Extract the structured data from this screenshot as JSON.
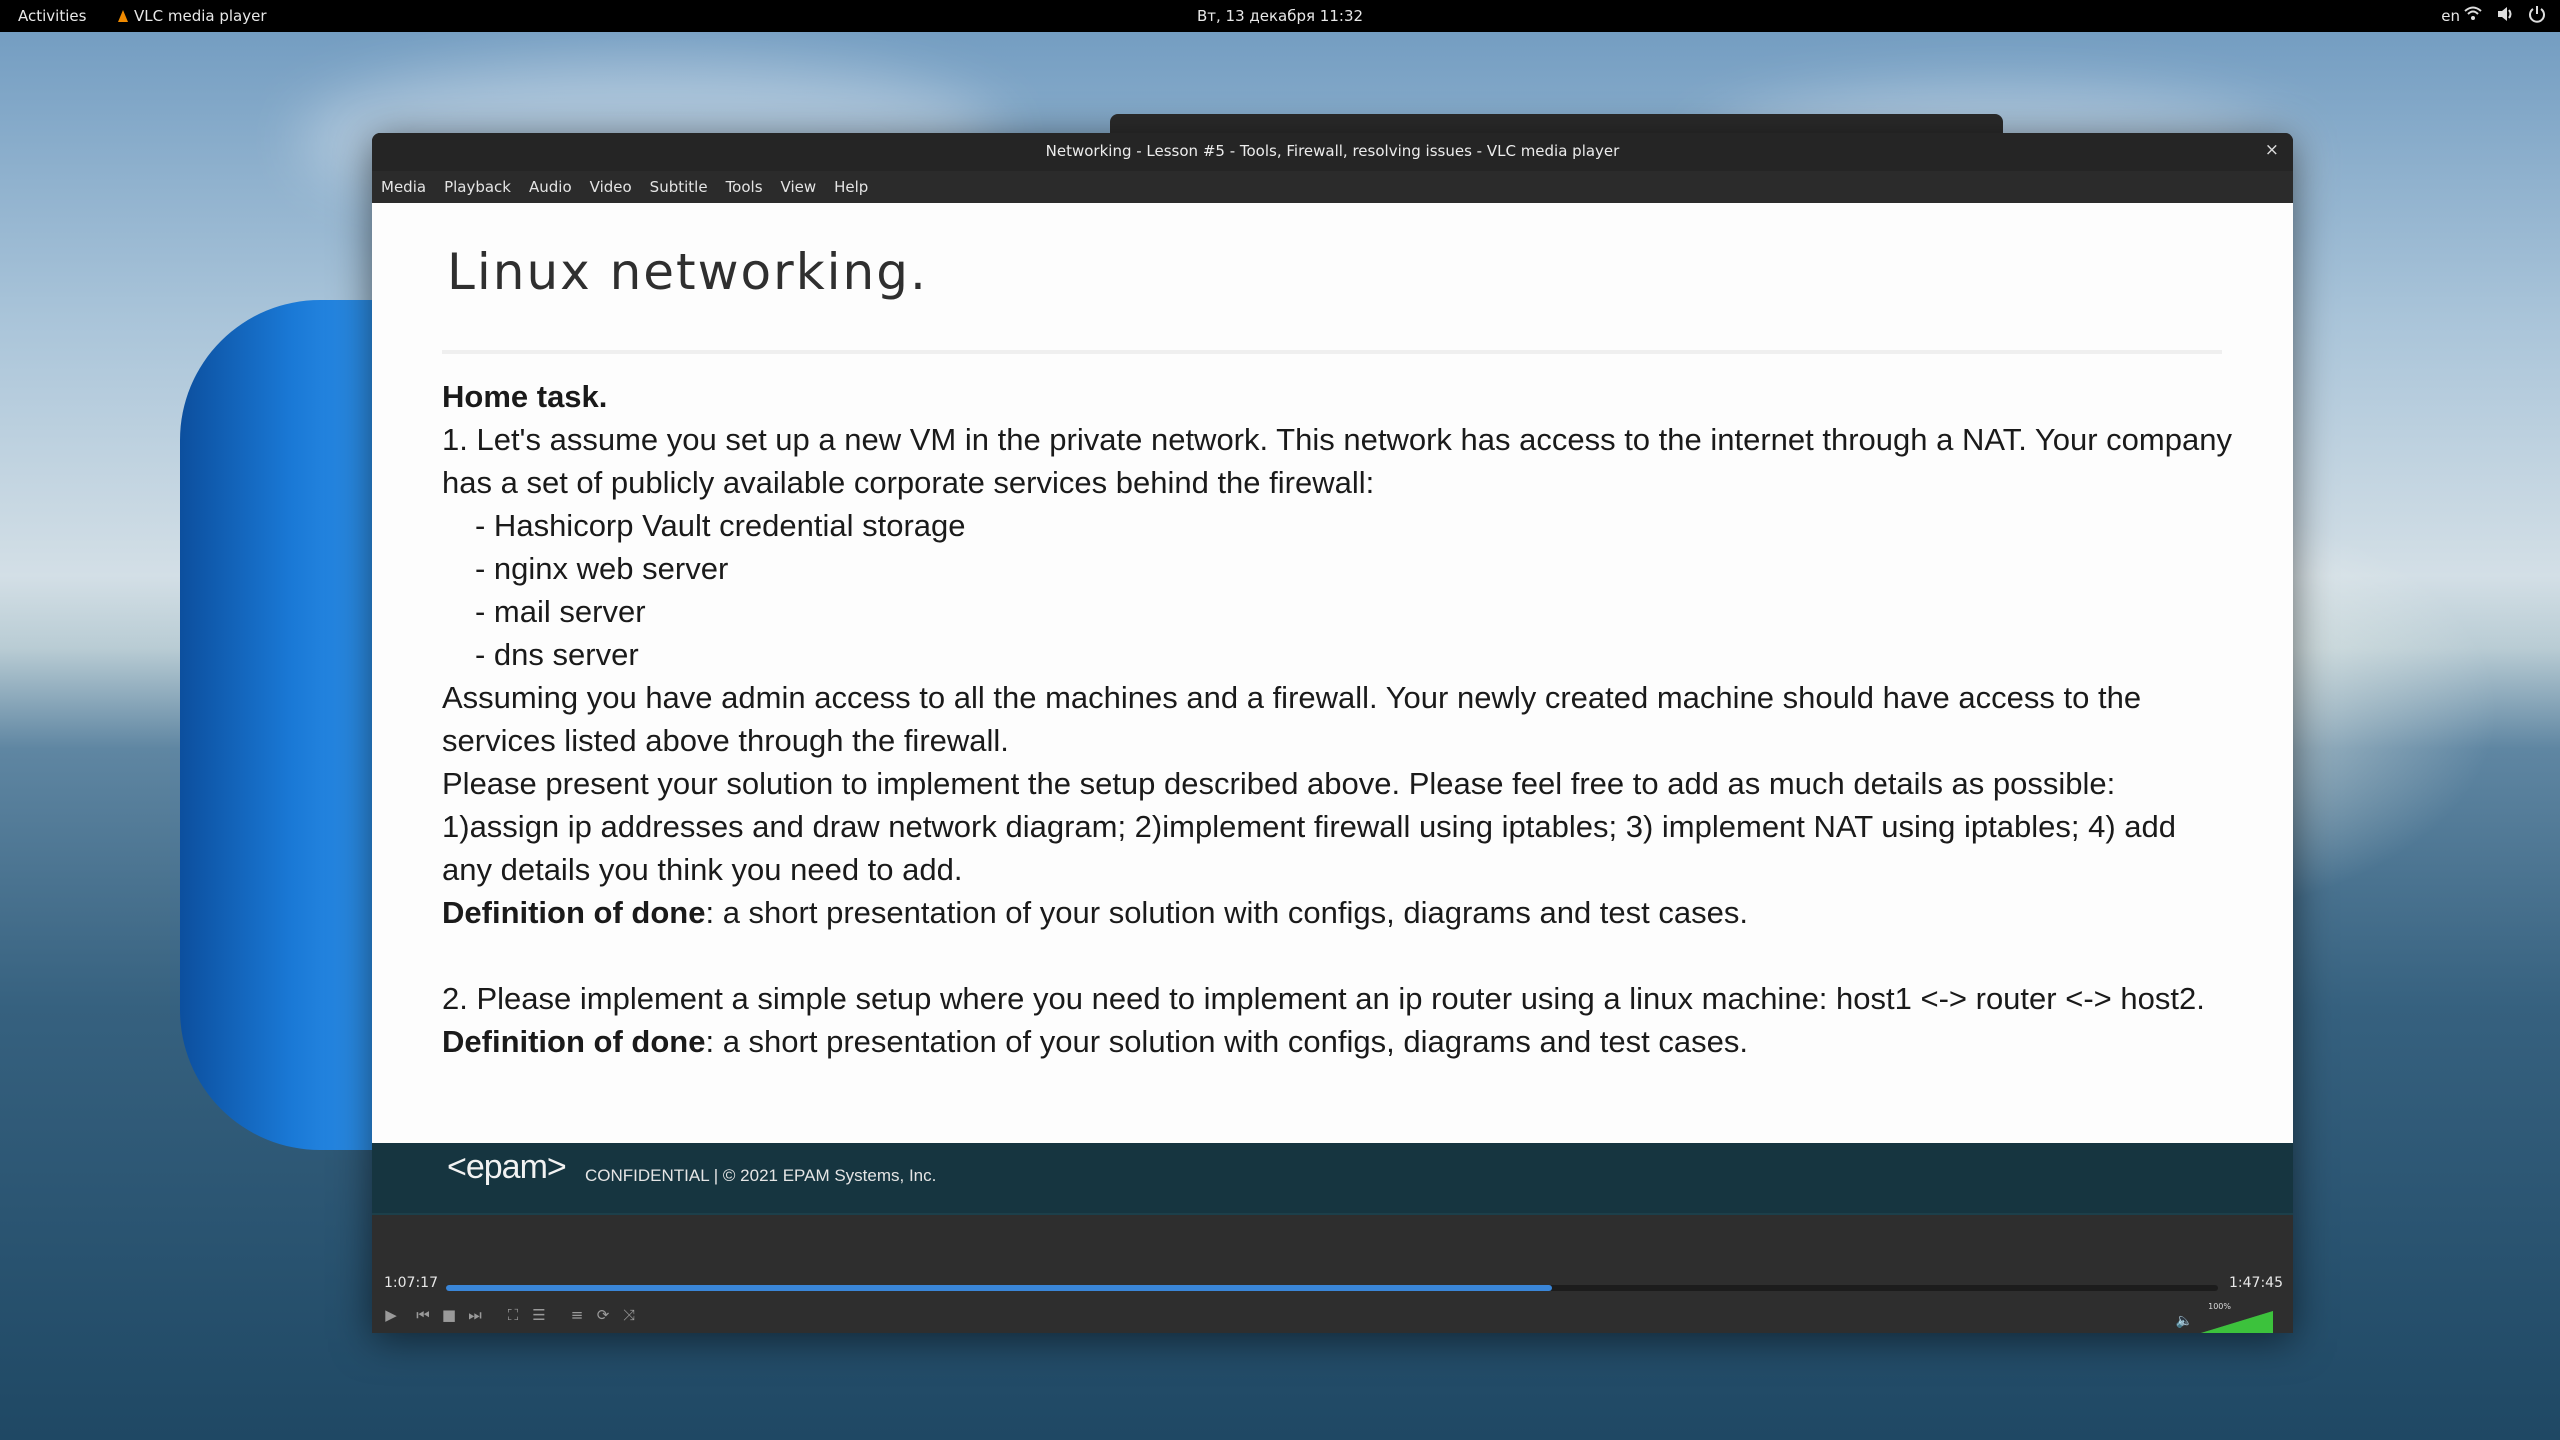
{
  "topbar": {
    "activities": "Activities",
    "app_name": "VLC media player",
    "clock": "Вт, 13 декабря  11:32",
    "language": "en"
  },
  "window": {
    "title": "Networking - Lesson #5 - Tools, Firewall, resolving issues - VLC media player",
    "close": "×"
  },
  "menu": [
    "Media",
    "Playback",
    "Audio",
    "Video",
    "Subtitle",
    "Tools",
    "View",
    "Help"
  ],
  "slide": {
    "title": "Linux networking.",
    "home_task": "Home task.",
    "task1_line1": "1. Let's assume you set up a new VM in the private network. This network has access to the internet through a NAT. Your company has a set of publicly available corporate services behind the firewall:",
    "bullets": [
      "- Hashicorp Vault credential storage",
      "- nginx web server",
      "- mail server",
      "- dns server"
    ],
    "assumption": "Assuming you have admin access to all the machines and a firewall. Your newly created machine should have access to the services listed above through the firewall.",
    "present": "Please present your solution to implement the setup described above. Please feel free to add as much details as possible: 1)assign ip addresses and draw network diagram; 2)implement firewall using iptables; 3) implement NAT using iptables; 4) add any details you think you need to add.",
    "dod_label": "Definition of done",
    "dod_text": ": a short presentation of your solution with configs, diagrams and test cases.",
    "task2": "2. Please implement a simple setup where you need to implement an ip router using a linux machine: host1 <-> router  <-> host2.",
    "footer_logo": "<epam>",
    "footer_text": "CONFIDENTIAL  |  © 2021 EPAM Systems, Inc."
  },
  "player": {
    "current_time": "1:07:17",
    "total_time": "1:47:45",
    "progress": 0.624,
    "volume_label": "100%",
    "volume": 1.0
  },
  "icons": {
    "play": "▶",
    "prev": "⏮",
    "stop": "■",
    "next": "⏭",
    "fullscreen": "⛶",
    "extended": "☰",
    "playlist": "≡",
    "loop": "⟳",
    "shuffle": "⤨",
    "volume": "🔈"
  },
  "colors": {
    "accent": "#3a86d8",
    "footer": "#163540",
    "volume": "#3cc23c"
  }
}
